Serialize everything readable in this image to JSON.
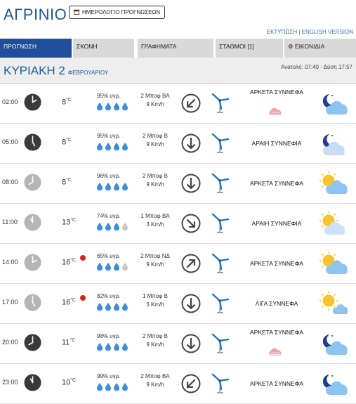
{
  "city": "ΑΓΡΙΝΙΟ",
  "calendar_button": "ΗΜΕΡΟΛΟΓΙΟ ΠΡΟΓΝΩΣΕΩΝ",
  "links": {
    "print": "ΕΚΤΥΠΩΣΗ",
    "sep": " | ",
    "english": "ENGLISH VERSION"
  },
  "tabs": [
    {
      "label": "ΠΡΟΓΝΩΣΗ",
      "active": true
    },
    {
      "label": "ΣΚΟΝΗ",
      "active": false
    },
    {
      "label": "ΓΡΑΦΗΜΑΤΑ",
      "active": false
    },
    {
      "label": "ΣΤΑΘΜΟΙ [1]",
      "active": false
    },
    {
      "label": "ΕΙΚΟΝΙΔΙΑ",
      "active": false
    }
  ],
  "day": {
    "name": "ΚΥΡΙΑΚΗ 2",
    "month": "ΦΕΒΡΟΥΑΡΙΟΥ",
    "sun": "Ανατολή: 07:40 - Δύση 17:57"
  },
  "rows": [
    {
      "time": "02:00",
      "night": true,
      "temp": "8",
      "unit": "°C",
      "alert": false,
      "humidity": "95% υγρ.",
      "drops": [
        1,
        1,
        1,
        1
      ],
      "wind_speed": "2 Μποφ ΒΑ",
      "wind_kmh": "9 Km/h",
      "wind_dir": "SW",
      "desc": "ΑΡΚΕΤΑ ΣΥΝΝΕΦΑ",
      "desc_icon": "pink-cloud-icon",
      "weather_icon": "moon-cloud-icon"
    },
    {
      "time": "05:00",
      "night": true,
      "temp": "8",
      "unit": "°C",
      "alert": false,
      "humidity": "95% υγρ.",
      "drops": [
        1,
        1,
        1,
        1
      ],
      "wind_speed": "2 Μποφ Β",
      "wind_kmh": "9 Km/h",
      "wind_dir": "S",
      "desc": "ΑΡΑΙΗ ΣΥΝΝΕΦΙΑ",
      "desc_icon": "",
      "weather_icon": "moon-thin-cloud-icon"
    },
    {
      "time": "08:00",
      "night": false,
      "temp": "8",
      "unit": "°C",
      "alert": false,
      "humidity": "96% υγρ.",
      "drops": [
        1,
        1,
        1,
        1
      ],
      "wind_speed": "2 Μποφ Β",
      "wind_kmh": "9 Km/h",
      "wind_dir": "S",
      "desc": "ΑΡΚΕΤΑ ΣΥΝΝΕΦΑ",
      "desc_icon": "",
      "weather_icon": "sun-cloud-icon"
    },
    {
      "time": "11:00",
      "night": false,
      "temp": "13",
      "unit": "°C",
      "alert": false,
      "humidity": "74% υγρ.",
      "drops": [
        1,
        1,
        1,
        0
      ],
      "wind_speed": "1 Μποφ ΒΑ",
      "wind_kmh": "3 Km/h",
      "wind_dir": "SE",
      "desc": "ΑΡΑΙΗ ΣΥΝΝΕΦΙΑ",
      "desc_icon": "",
      "weather_icon": "sun-thin-cloud-icon"
    },
    {
      "time": "14:00",
      "night": false,
      "temp": "16",
      "unit": "°C",
      "alert": true,
      "humidity": "65% υγρ.",
      "drops": [
        1,
        1,
        1,
        0
      ],
      "wind_speed": "2 Μποφ ΝΔ",
      "wind_kmh": "9 Km/h",
      "wind_dir": "NE",
      "desc": "ΑΡΚΕΤΑ ΣΥΝΝΕΦΑ",
      "desc_icon": "",
      "weather_icon": "sun-cloud-icon"
    },
    {
      "time": "17:00",
      "night": false,
      "temp": "16",
      "unit": "°C",
      "alert": true,
      "humidity": "82% υγρ.",
      "drops": [
        1,
        1,
        1,
        1
      ],
      "wind_speed": "1 Μποφ Β",
      "wind_kmh": "3 Km/h",
      "wind_dir": "S",
      "desc": "ΛΙΓΑ ΣΥΝΝΕΦΑ",
      "desc_icon": "",
      "weather_icon": "sun-small-cloud-icon"
    },
    {
      "time": "20:00",
      "night": true,
      "temp": "11",
      "unit": "°C",
      "alert": false,
      "humidity": "98% υγρ.",
      "drops": [
        1,
        1,
        1,
        1
      ],
      "wind_speed": "2 Μποφ Β",
      "wind_kmh": "9 Km/h",
      "wind_dir": "S",
      "desc": "ΑΡΚΕΤΑ ΣΥΝΝΕΦΑ",
      "desc_icon": "pink-cloud-icon",
      "weather_icon": "moon-cloud-icon"
    },
    {
      "time": "23:00",
      "night": true,
      "temp": "10",
      "unit": "°C",
      "alert": false,
      "humidity": "99% υγρ.",
      "drops": [
        1,
        1,
        1,
        1
      ],
      "wind_speed": "2 Μποφ ΒΑ",
      "wind_kmh": "9 Km/h",
      "wind_dir": "SW",
      "desc": "ΑΡΚΕΤΑ ΣΥΝΝΕΦΑ",
      "desc_icon": "",
      "weather_icon": "moon-cloud-icon"
    }
  ],
  "colors": {
    "brand": "#1f5a9c",
    "tab_active": "#1f4e9a",
    "tab": "#d9d9d9",
    "drop": "#3b8fd9",
    "alert": "#e51b1b"
  }
}
